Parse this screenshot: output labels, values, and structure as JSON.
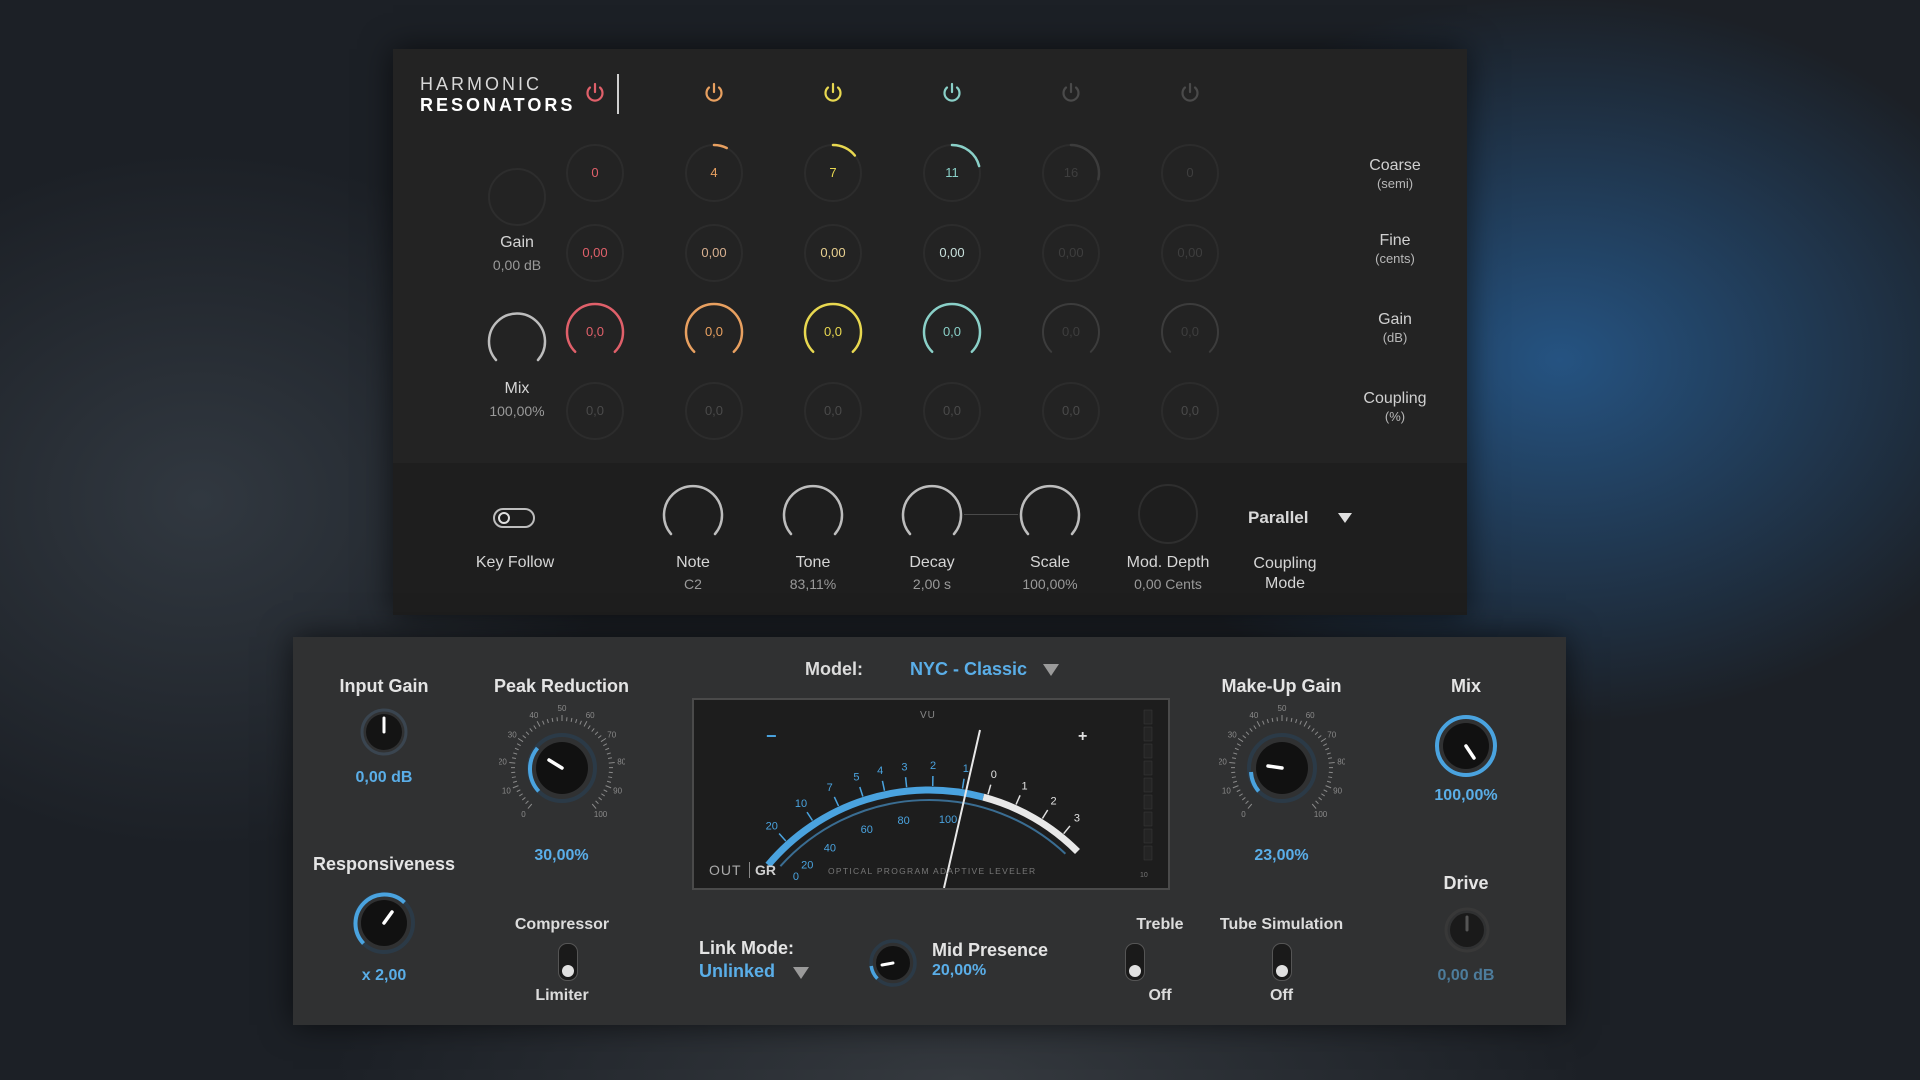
{
  "resonators": {
    "title_line1": "HARMONIC",
    "title_line2": "RESONATORS",
    "colors": [
      "#e0606a",
      "#e8a060",
      "#e8d850",
      "#8ad0c8",
      "#5a5a5a",
      "#5a5a5a"
    ],
    "power_states": [
      true,
      true,
      true,
      true,
      false,
      false
    ],
    "coarse": [
      "0",
      "4",
      "7",
      "11",
      "16",
      "0"
    ],
    "fine": [
      "0,00",
      "0,00",
      "0,00",
      "0,00",
      "0,00",
      "0,00"
    ],
    "gain": [
      "0,0",
      "0,0",
      "0,0",
      "0,0",
      "0,0",
      "0,0"
    ],
    "coupling": [
      "0,0",
      "0,0",
      "0,0",
      "0,0",
      "0,0",
      "0,0"
    ],
    "row_labels": {
      "coarse": "Coarse",
      "coarse_unit": "(semi)",
      "fine": "Fine",
      "fine_unit": "(cents)",
      "gain": "Gain",
      "gain_unit": "(dB)",
      "coupling": "Coupling",
      "coupling_unit": "(%)"
    },
    "left": {
      "gain_label": "Gain",
      "gain_value": "0,00 dB",
      "mix_label": "Mix",
      "mix_value": "100,00%"
    },
    "bottom": {
      "key_follow_label": "Key Follow",
      "note_label": "Note",
      "note_value": "C2",
      "tone_label": "Tone",
      "tone_value": "83,11%",
      "decay_label": "Decay",
      "decay_value": "2,00 s",
      "scale_label": "Scale",
      "scale_value": "100,00%",
      "mod_depth_label": "Mod. Depth",
      "mod_depth_value": "0,00 Cents",
      "coupling_mode_value": "Parallel",
      "coupling_mode_label_1": "Coupling",
      "coupling_mode_label_2": "Mode"
    }
  },
  "compressor": {
    "input_gain_label": "Input Gain",
    "input_gain_value": "0,00 dB",
    "peak_reduction_label": "Peak Reduction",
    "peak_reduction_value": "30,00%",
    "model_label": "Model:",
    "model_value": "NYC - Classic",
    "makeup_gain_label": "Make-Up Gain",
    "makeup_gain_value": "23,00%",
    "mix_label": "Mix",
    "mix_value": "100,00%",
    "responsiveness_label": "Responsiveness",
    "responsiveness_value": "x 2,00",
    "compressor_label": "Compressor",
    "limiter_label": "Limiter",
    "link_mode_label": "Link Mode:",
    "link_mode_value": "Unlinked",
    "mid_presence_label": "Mid Presence",
    "mid_presence_value": "20,00%",
    "treble_label": "Treble",
    "treble_value": "Off",
    "tube_label": "Tube Simulation",
    "tube_value": "Off",
    "drive_label": "Drive",
    "drive_value": "0,00 dB",
    "dial_ticks": [
      "0",
      "10",
      "20",
      "30",
      "40",
      "50",
      "60",
      "70",
      "80",
      "90",
      "100"
    ],
    "accent": "#4aa3df"
  },
  "vu_meter": {
    "title": "VU",
    "minus": "−",
    "plus": "+",
    "scale_top": [
      "20",
      "10",
      "7",
      "5",
      "4",
      "3",
      "2",
      "1",
      "0",
      "1",
      "2",
      "3"
    ],
    "scale_bottom": [
      "0",
      "20",
      "40",
      "60",
      "80",
      "100"
    ],
    "out_label": "OUT",
    "gr_label": "GR",
    "caption": "OPTICAL PROGRAM ADAPTIVE LEVELER",
    "side_scale_label": "10"
  }
}
